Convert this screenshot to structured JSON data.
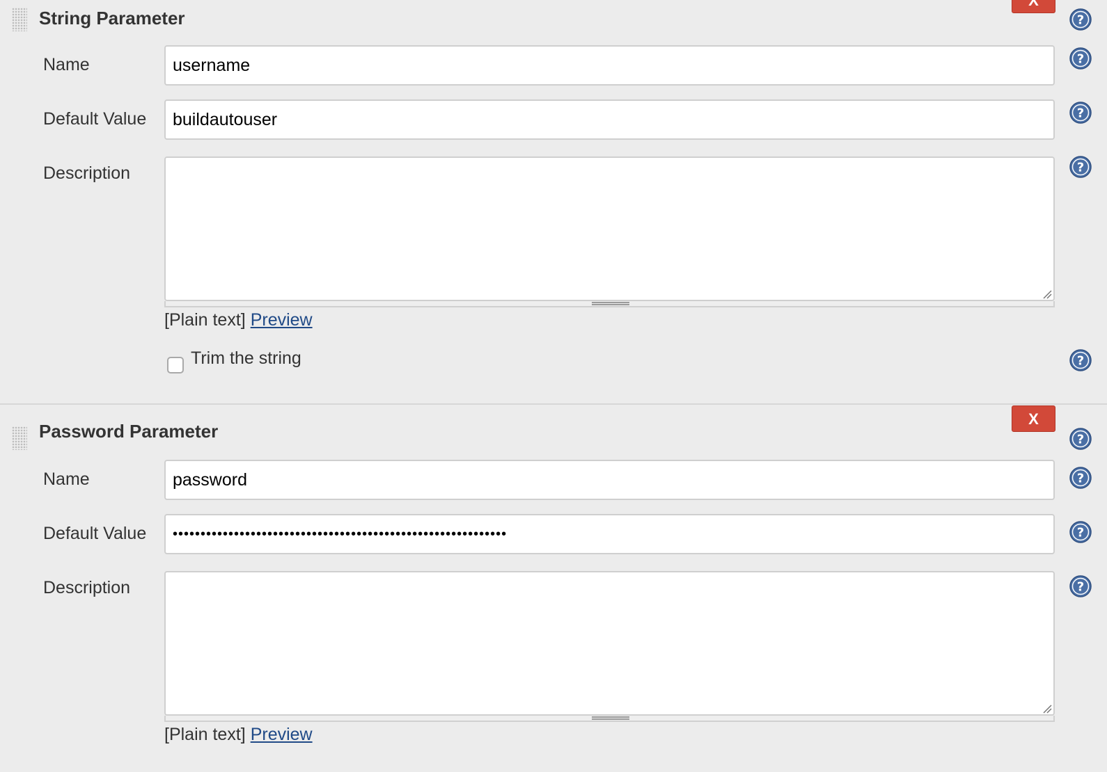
{
  "string_parameter": {
    "title": "String Parameter",
    "delete_label": "X",
    "name_label": "Name",
    "name_value": "username",
    "default_label": "Default Value",
    "default_value": "buildautouser",
    "description_label": "Description",
    "description_value": "",
    "markup_prefix": "[Plain text]",
    "preview_label": "Preview",
    "trim_label": "Trim the string",
    "trim_checked": false
  },
  "password_parameter": {
    "title": "Password Parameter",
    "delete_label": "X",
    "name_label": "Name",
    "name_value": "password",
    "default_label": "Default Value",
    "default_value": "••••••••••••••••••••••••••••••••••••••••••••••••••••••••••••",
    "description_label": "Description",
    "description_value": "",
    "markup_prefix": "[Plain text]",
    "preview_label": "Preview"
  },
  "colors": {
    "background": "#ececec",
    "delete_button": "#d24939",
    "help_icon": "#4a6fa5",
    "link": "#204a87"
  },
  "icons": {
    "help": "question-mark-circle-icon",
    "drag": "drag-handle-icon",
    "resize": "resize-grip-icon"
  }
}
